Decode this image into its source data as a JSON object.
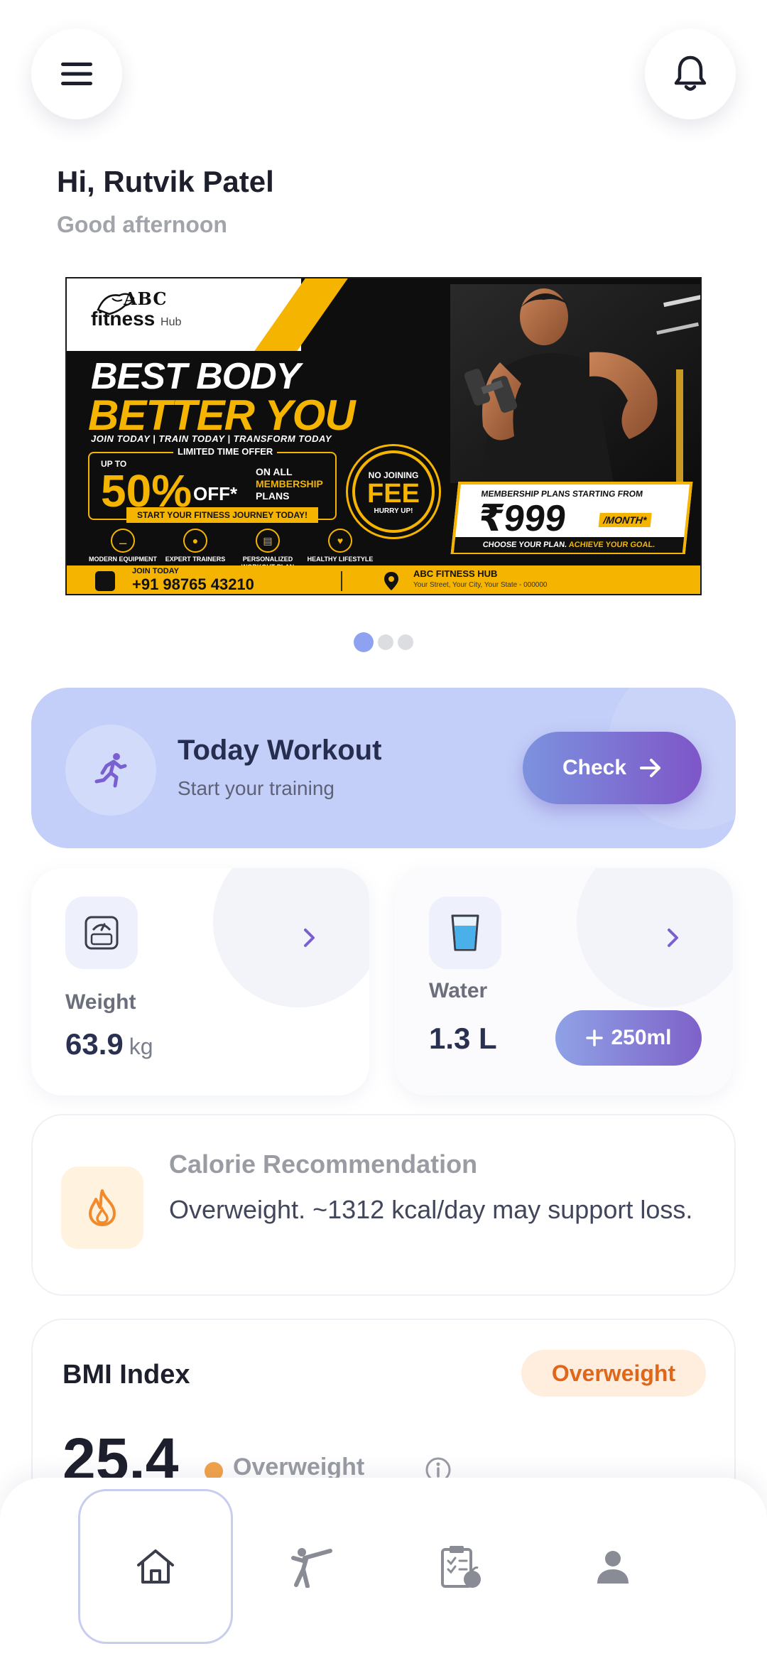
{
  "header": {
    "menu_icon": "hamburger-menu-icon",
    "bell_icon": "bell-icon",
    "greeting": "Hi, Rutvik Patel",
    "subgreeting": "Good afternoon"
  },
  "banner": {
    "logo_top": "ABC",
    "logo_main": "fitness",
    "logo_sub": "Hub",
    "headline_1": "BEST BODY",
    "headline_2": "BETTER YOU",
    "tagline": "JOIN TODAY  |  TRAIN TODAY  |  TRANSFORM TODAY",
    "offer_heading": "LIMITED TIME OFFER",
    "up_to": "UP TO",
    "discount": "50%",
    "off": "OFF*",
    "on_all": "ON ALL",
    "membership": "MEMBERSHIP",
    "plans": "PLANS",
    "no_joining": "NO JOINING",
    "fee": "FEE",
    "hurry": "HURRY UP!",
    "start_journey": "START YOUR FITNESS JOURNEY TODAY!",
    "features": [
      "MODERN EQUIPMENT",
      "EXPERT TRAINERS",
      "PERSONALIZED WORKOUT PLAN",
      "HEALTHY LIFESTYLE"
    ],
    "price_heading": "MEMBERSHIP PLANS STARTING FROM",
    "price": "₹999",
    "per_month": "/MONTH*",
    "choose_plan": "CHOOSE YOUR PLAN.",
    "achieve_goal": "ACHIEVE YOUR GOAL.",
    "join_today": "JOIN TODAY",
    "phone": "+91 98765 43210",
    "hub_name": "ABC FITNESS HUB",
    "address": "Your Street, Your City, Your State - 000000",
    "active_slide": 1,
    "slide_count": 3
  },
  "workout": {
    "icon": "running-person-icon",
    "title": "Today Workout",
    "subtitle": "Start your training",
    "check_label": "Check"
  },
  "weight": {
    "icon": "scale-icon",
    "label": "Weight",
    "value": "63.9",
    "unit": "kg"
  },
  "water": {
    "icon": "water-glass-icon",
    "label": "Water",
    "value": "1.3 L",
    "add_label": "250ml"
  },
  "calorie": {
    "icon": "flame-icon",
    "title": "Calorie Recommendation",
    "text": "Overweight. ~1312 kcal/day may support loss."
  },
  "bmi": {
    "title": "BMI Index",
    "badge": "Overweight",
    "value": "25.4",
    "category": "Overweight",
    "info_icon": "info-icon"
  },
  "nav": {
    "items": [
      "home",
      "workout",
      "diet",
      "profile"
    ],
    "active": "home"
  },
  "colors": {
    "accent_blue": "#c3cff8",
    "button_gradient_start": "#7c92de",
    "button_gradient_end": "#7e56c8",
    "banner_yellow": "#f5b400",
    "overweight_orange": "#e0661a"
  }
}
